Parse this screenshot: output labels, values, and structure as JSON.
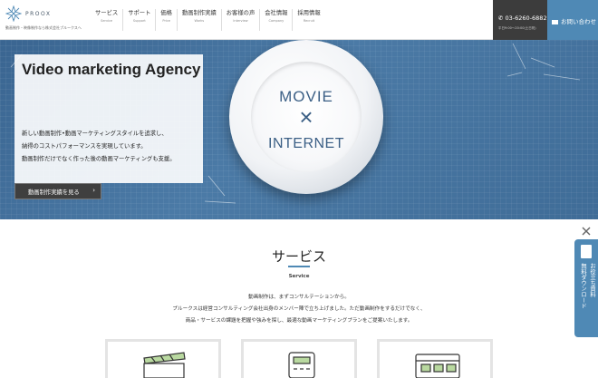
{
  "brand": {
    "name": "PROOX",
    "tagline": "動画制作・映像制作なら株式会社プルークスへ"
  },
  "nav": {
    "items": [
      {
        "jp": "サービス",
        "en": "Service"
      },
      {
        "jp": "サポート",
        "en": "Support"
      },
      {
        "jp": "価格",
        "en": "Price"
      },
      {
        "jp": "動画制作実績",
        "en": "Works"
      },
      {
        "jp": "お客様の声",
        "en": "Interview"
      },
      {
        "jp": "会社情報",
        "en": "Company"
      },
      {
        "jp": "採用情報",
        "en": "Recruit"
      }
    ]
  },
  "phone": {
    "number": "03-6260-6882",
    "hours": "平日9:00〜20:00(土日祝)"
  },
  "contact": {
    "label": "お問い合わせ"
  },
  "hero": {
    "title": "Video marketing Agency",
    "lines": [
      "新しい動画制作•動画マーケティングスタイルを追求し、",
      "納得のコストパフォーマンスを実現しています。",
      "動画制作だけでなく作った後の動画マーケティングも支援。"
    ],
    "plate_top": "MOVIE",
    "plate_symbol": "×",
    "plate_bottom": "INTERNET",
    "works_button": "動画制作実績を見る",
    "works_arrow": "›"
  },
  "service": {
    "title": "サービス",
    "subtitle": "Service",
    "desc": [
      "動画制作は、まずコンサルテーションから。",
      "プルークスは経営コンサルティング会社出身のメンバー陣で立ち上げました。ただ動画制作をするだけでなく、",
      "商品・サービスの課題を把握や強みを探し、最適な動画マーケティングプランをご提案いたします。"
    ]
  },
  "side_tab": {
    "col1": "お役立ち資料",
    "col2": "無料ダウンロード"
  },
  "colors": {
    "accent": "#4f89b5",
    "hero": "#3f6c97",
    "dark": "#3c3c3c"
  }
}
